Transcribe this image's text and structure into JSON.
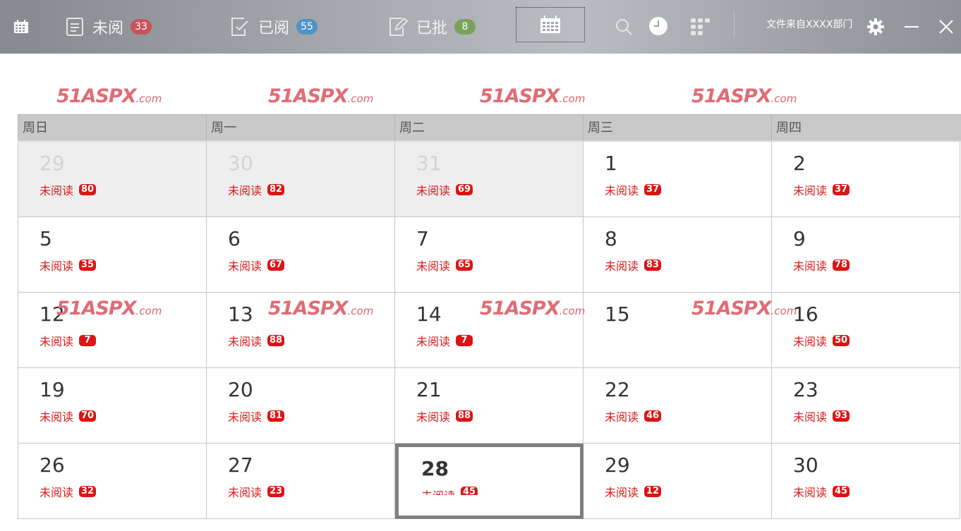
{
  "toolbar": {
    "tabs": [
      {
        "label": "未阅",
        "count": "33",
        "color": "#c7545c"
      },
      {
        "label": "已阅",
        "count": "55",
        "color": "#4f93c7"
      },
      {
        "label": "已批",
        "count": "8",
        "color": "#7aa35a"
      }
    ],
    "department": "文件来自XXXX部门"
  },
  "watermark": {
    "main": "51ASPX",
    "suffix": ".com"
  },
  "calendar": {
    "weekdays": [
      "周日",
      "周一",
      "周二",
      "周三",
      "周四"
    ],
    "unread_label": "未阅读",
    "rows": [
      [
        {
          "day": "29",
          "count": "80",
          "prev": true
        },
        {
          "day": "30",
          "count": "82",
          "prev": true
        },
        {
          "day": "31",
          "count": "69",
          "prev": true
        },
        {
          "day": "1",
          "count": "37"
        },
        {
          "day": "2",
          "count": "37"
        }
      ],
      [
        {
          "day": "5",
          "count": "35"
        },
        {
          "day": "6",
          "count": "67"
        },
        {
          "day": "7",
          "count": "65"
        },
        {
          "day": "8",
          "count": "83"
        },
        {
          "day": "9",
          "count": "78"
        }
      ],
      [
        {
          "day": "12",
          "count": "7"
        },
        {
          "day": "13",
          "count": "88"
        },
        {
          "day": "14",
          "count": "7"
        },
        {
          "day": "15",
          "count": null
        },
        {
          "day": "16",
          "count": "50"
        }
      ],
      [
        {
          "day": "19",
          "count": "70"
        },
        {
          "day": "20",
          "count": "81"
        },
        {
          "day": "21",
          "count": "88"
        },
        {
          "day": "22",
          "count": "46"
        },
        {
          "day": "23",
          "count": "93"
        }
      ],
      [
        {
          "day": "26",
          "count": "32"
        },
        {
          "day": "27",
          "count": "23"
        },
        {
          "day": "28",
          "count": "45",
          "today": true
        },
        {
          "day": "29",
          "count": "12"
        },
        {
          "day": "30",
          "count": "45"
        }
      ]
    ]
  }
}
